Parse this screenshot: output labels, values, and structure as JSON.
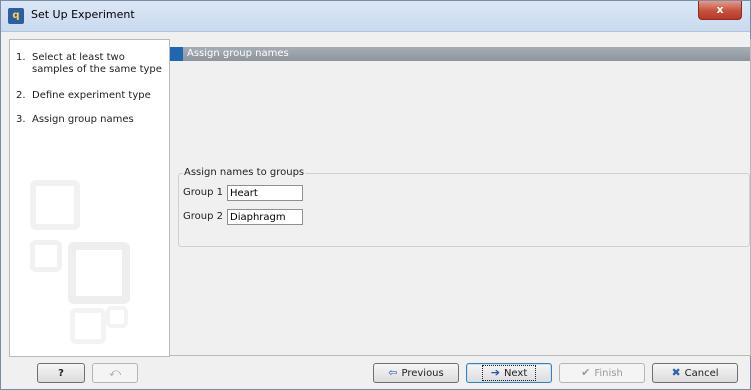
{
  "window": {
    "title": "Set Up Experiment",
    "app_icon_glyph": "q",
    "close_glyph": "x"
  },
  "steps": [
    {
      "num": "1.",
      "label": "Select at least two samples of the same type"
    },
    {
      "num": "2.",
      "label": "Define experiment type"
    },
    {
      "num": "3.",
      "label": "Assign group names"
    }
  ],
  "content": {
    "header": "Assign group names",
    "group_box": {
      "legend": "Assign names to groups",
      "rows": [
        {
          "label": "Group 1",
          "value": "Heart"
        },
        {
          "label": "Group 2",
          "value": "Diaphragm"
        }
      ]
    }
  },
  "buttons": {
    "help": {
      "label": "?"
    },
    "reset": {
      "icon": "undo-icon",
      "glyph": "⤺"
    },
    "previous": {
      "label": "Previous",
      "icon": "arrow-left-icon",
      "glyph": "⇦"
    },
    "next": {
      "label": "Next",
      "icon": "arrow-right-icon",
      "glyph": "➔"
    },
    "finish": {
      "label": "Finish",
      "icon": "checkmark-icon",
      "glyph": "✔"
    },
    "cancel": {
      "label": "Cancel",
      "icon": "x-cross-icon",
      "glyph": "✖"
    }
  },
  "colors": {
    "accent_blue": "#1f67b3",
    "header_grey": "#9aa1a8",
    "cancel_icon": "#2b63b0",
    "next_icon": "#1a56a6",
    "prev_icon": "#2a5fab",
    "close_red": "#c4513e"
  }
}
